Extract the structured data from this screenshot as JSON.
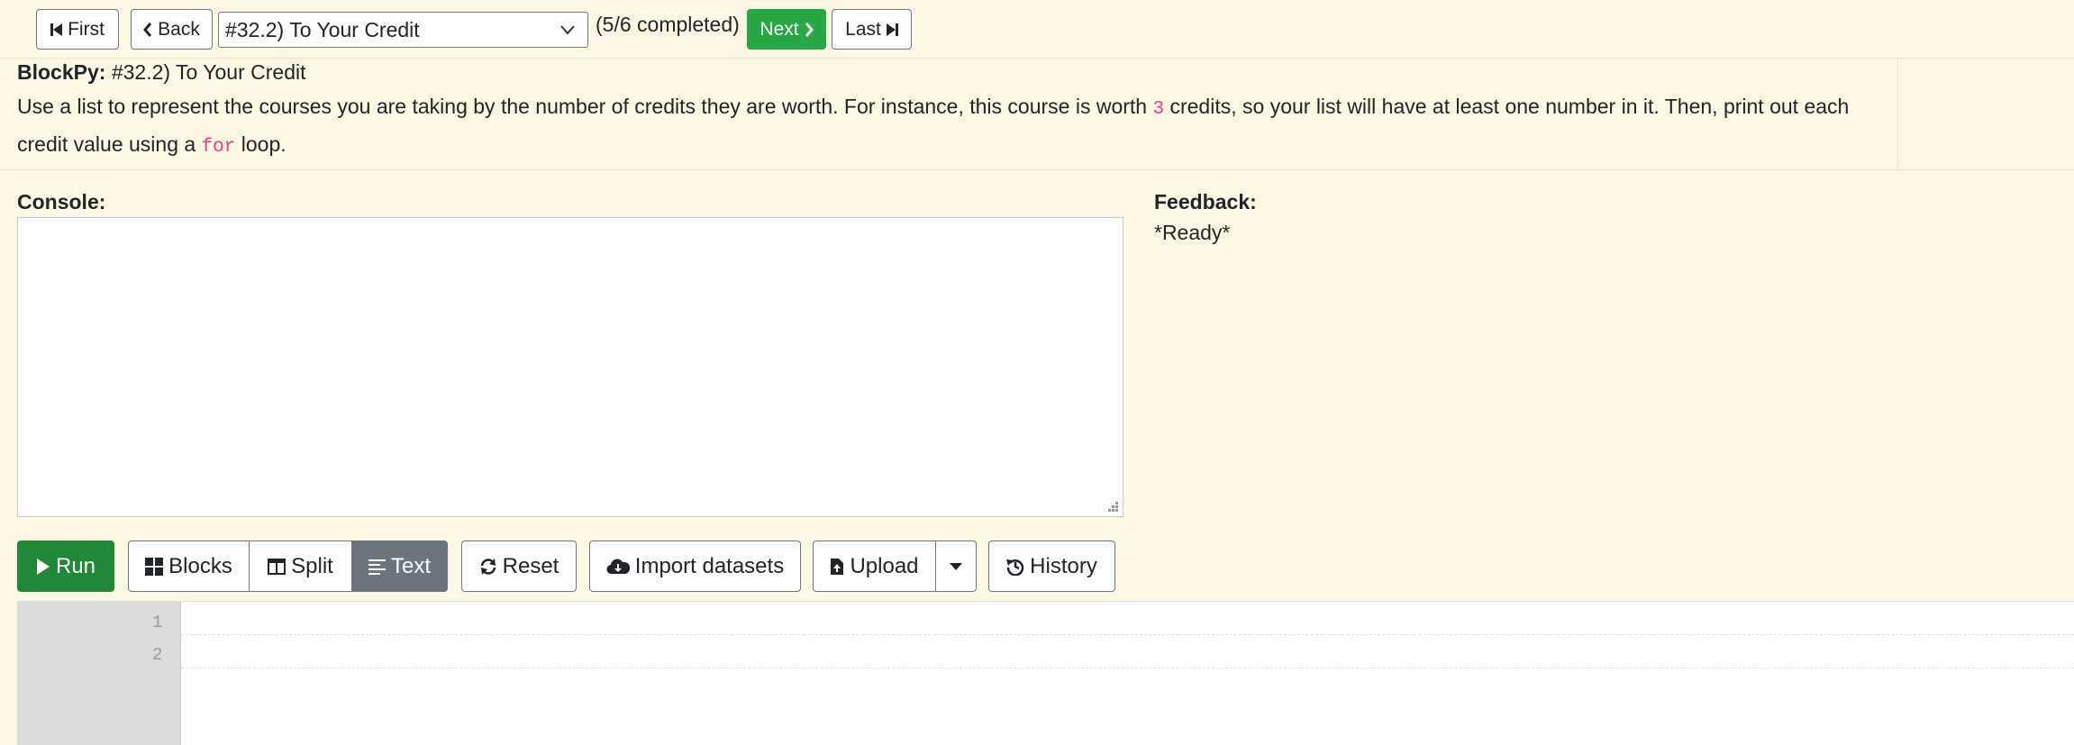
{
  "nav": {
    "first_label": "First",
    "back_label": "Back",
    "assignment_select_value": "#32.2) To Your Credit",
    "progress_text": "(5/6 completed)",
    "next_label": "Next",
    "last_label": "Last"
  },
  "prompt": {
    "app_name": "BlockPy:",
    "title": "#32.2) To Your Credit",
    "desc_part1": "Use a list to represent the courses you are taking by the number of credits they are worth. For instance, this course is worth ",
    "desc_code1": "3",
    "desc_part2": " credits, so your list will have at least one number in it. Then, print out each credit value using a ",
    "desc_code2": "for",
    "desc_part3": " loop."
  },
  "console": {
    "label": "Console:"
  },
  "feedback": {
    "label": "Feedback:",
    "status": "*Ready*"
  },
  "toolbar": {
    "run_label": "Run",
    "blocks_label": "Blocks",
    "split_label": "Split",
    "text_label": "Text",
    "reset_label": "Reset",
    "import_label": "Import datasets",
    "upload_label": "Upload",
    "history_label": "History"
  },
  "editor": {
    "line_numbers": [
      "1",
      "2"
    ]
  },
  "colors": {
    "background": "#fcf8e3",
    "run_green": "#218838",
    "next_green": "#28a745",
    "active_mode": "#6c757d",
    "code_pink": "#e83e8c"
  }
}
